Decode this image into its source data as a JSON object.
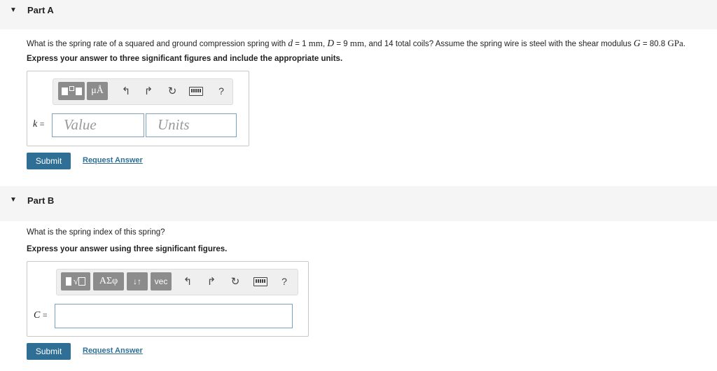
{
  "partA": {
    "title": "Part A",
    "question": {
      "t1": "What is the spring rate of a squared and ground compression spring with ",
      "d_sym": "d",
      "t2": " = 1 ",
      "mm1": "mm",
      "t3": ", ",
      "D_sym": "D",
      "t4": " = 9 ",
      "mm2": "mm",
      "t5": ", and 14 total coils? Assume the spring wire is steel with the shear modulus ",
      "G_sym": "G",
      "t6": " = 80.8 ",
      "gpa": "GPa",
      "t7": "."
    },
    "instruction": "Express your answer to three significant figures and include the appropriate units.",
    "toolbar": {
      "mu_label": "μÅ",
      "help": "?"
    },
    "var_symbol": "k",
    "equals": "=",
    "value_placeholder": "Value",
    "units_placeholder": "Units",
    "submit_label": "Submit",
    "request_label": "Request Answer"
  },
  "partB": {
    "title": "Part B",
    "question": "What is the spring index of this spring?",
    "instruction": "Express your answer using three significant figures.",
    "toolbar": {
      "greek_label": "ΑΣφ",
      "arrows_label": "↓↑",
      "vec_label": "vec",
      "help": "?"
    },
    "var_symbol": "C",
    "equals": "=",
    "submit_label": "Submit",
    "request_label": "Request Answer"
  },
  "icons": {
    "caret": "caret-down-icon",
    "undo": "undo-icon",
    "redo": "redo-icon",
    "reset": "reset-icon",
    "keyboard": "keyboard-icon",
    "help": "help-icon",
    "template": "template-icon",
    "sqrt": "radical-template-icon"
  },
  "colors": {
    "button": "#2f6f96",
    "link": "#2f6f96",
    "header_bg": "#f5f5f5",
    "tool_btn": "#8c8c8c"
  }
}
